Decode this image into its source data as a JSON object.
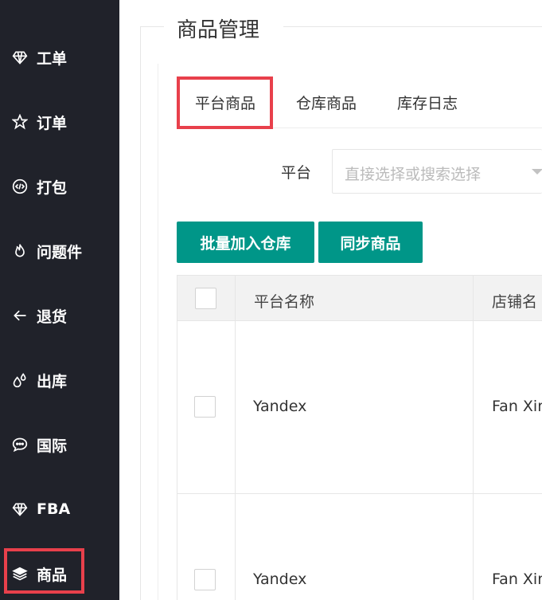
{
  "sidebar": {
    "items": [
      {
        "label": "工单",
        "icon": "diamond-icon"
      },
      {
        "label": "订单",
        "icon": "star-icon"
      },
      {
        "label": "打包",
        "icon": "code-icon"
      },
      {
        "label": "问题件",
        "icon": "fire-icon"
      },
      {
        "label": "退货",
        "icon": "arrow-left-icon"
      },
      {
        "label": "出库",
        "icon": "drops-icon"
      },
      {
        "label": "国际",
        "icon": "chat-icon"
      },
      {
        "label": "FBA",
        "icon": "diamond-icon"
      },
      {
        "label": "商品",
        "icon": "layers-icon"
      }
    ]
  },
  "page": {
    "title": "商品管理"
  },
  "tabs": [
    {
      "label": "平台商品"
    },
    {
      "label": "仓库商品"
    },
    {
      "label": "库存日志"
    }
  ],
  "filter": {
    "label": "平台",
    "placeholder": "直接选择或搜索选择"
  },
  "toolbar": {
    "batch_add_label": "批量加入仓库",
    "sync_label": "同步商品"
  },
  "table": {
    "headers": [
      "平台名称",
      "店铺名"
    ],
    "rows": [
      {
        "platform": "Yandex",
        "shop": "Fan Xin"
      },
      {
        "platform": "Yandex",
        "shop": "Fan Xin"
      }
    ]
  },
  "colors": {
    "sidebar_bg": "#20222a",
    "accent": "#009688",
    "highlight": "#e8404b"
  }
}
